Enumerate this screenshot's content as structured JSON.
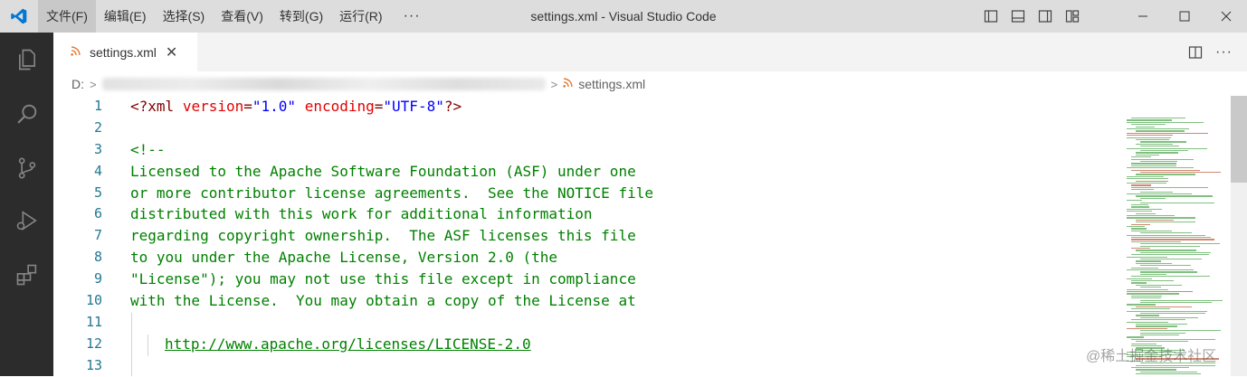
{
  "app": {
    "window_title": "settings.xml - Visual Studio Code"
  },
  "menu": [
    {
      "label": "文件(F)",
      "name": "menu-file"
    },
    {
      "label": "编辑(E)",
      "name": "menu-edit"
    },
    {
      "label": "选择(S)",
      "name": "menu-selection"
    },
    {
      "label": "查看(V)",
      "name": "menu-view"
    },
    {
      "label": "转到(G)",
      "name": "menu-go"
    },
    {
      "label": "运行(R)",
      "name": "menu-run"
    }
  ],
  "menu_more": "···",
  "tab": {
    "label": "settings.xml",
    "close": "✕"
  },
  "tab_more": "···",
  "breadcrumb": {
    "drive": "D:",
    "separator": ">",
    "file": "settings.xml"
  },
  "activity_icons": [
    "explorer-icon",
    "search-icon",
    "source-control-icon",
    "run-debug-icon",
    "extensions-icon"
  ],
  "colors": {
    "accent": "#0078d4",
    "titlebar": "#dddddd",
    "activity_bar": "#2c2c2c",
    "line_number": "#237893",
    "comment": "#008000"
  },
  "editor": {
    "line_numbers": [
      "1",
      "2",
      "3",
      "4",
      "5",
      "6",
      "7",
      "8",
      "9",
      "10",
      "11",
      "12",
      "13"
    ],
    "xml_decl": {
      "open": "<?xml",
      "attr1": "version",
      "eq1": "=",
      "val1": "\"1.0\"",
      "attr2": "encoding",
      "eq2": "=",
      "val2": "\"UTF-8\"",
      "close": "?>"
    },
    "lines": [
      "",
      "<!--",
      "Licensed to the Apache Software Foundation (ASF) under one",
      "or more contributor license agreements.  See the NOTICE file",
      "distributed with this work for additional information",
      "regarding copyright ownership.  The ASF licenses this file",
      "to you under the Apache License, Version 2.0 (the",
      "\"License\"); you may not use this file except in compliance",
      "with the License.  You may obtain a copy of the License at",
      "",
      "",
      ""
    ],
    "link": "http://www.apache.org/licenses/LICENSE-2.0"
  },
  "watermark": "@稀土掘金技术社区"
}
